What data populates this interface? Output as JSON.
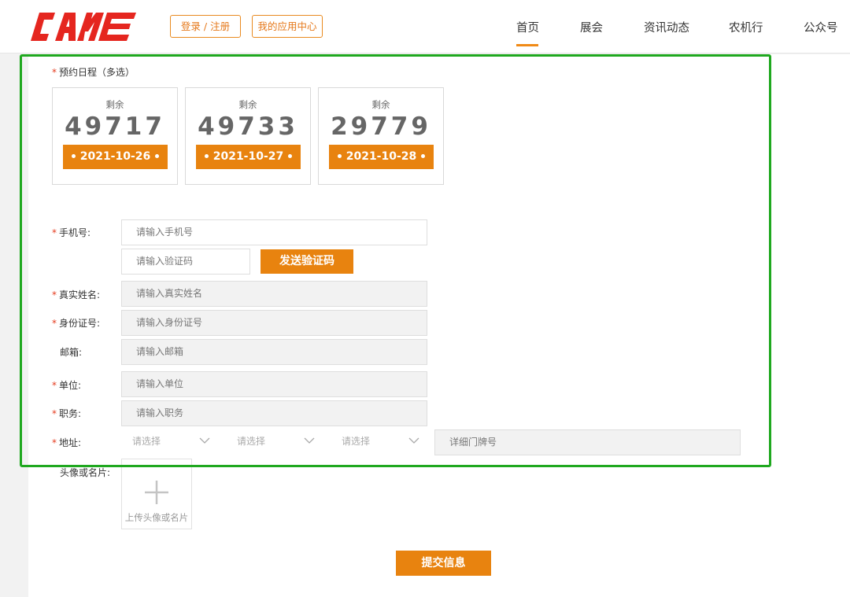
{
  "header": {
    "logo_text": "CAME",
    "login_label": "登录 / 注册",
    "app_center_label": "我的应用中心",
    "nav": [
      "首页",
      "展会",
      "资讯动态",
      "农机行",
      "公众号"
    ],
    "active_nav": "首页"
  },
  "schedule": {
    "label": "预约日程（多选）",
    "cards": [
      {
        "remain_label": "剩余",
        "count": "49717",
        "date": "2021-10-26"
      },
      {
        "remain_label": "剩余",
        "count": "49733",
        "date": "2021-10-27"
      },
      {
        "remain_label": "剩余",
        "count": "29779",
        "date": "2021-10-28"
      }
    ]
  },
  "form": {
    "phone_label": "手机号:",
    "phone_placeholder": "请输入手机号",
    "code_placeholder": "请输入验证码",
    "send_code_label": "发送验证码",
    "name_label": "真实姓名:",
    "name_placeholder": "请输入真实姓名",
    "id_label": "身份证号:",
    "id_placeholder": "请输入身份证号",
    "email_label": "邮箱:",
    "email_placeholder": "请输入邮箱",
    "company_label": "单位:",
    "company_placeholder": "请输入单位",
    "position_label": "职务:",
    "position_placeholder": "请输入职务",
    "address_label": "地址:",
    "address_selects": [
      "请选择",
      "请选择",
      "请选择"
    ],
    "address_detail_placeholder": "详细门牌号",
    "avatar_label": "头像或名片:",
    "upload_label": "上传头像或名片",
    "submit_label": "提交信息"
  },
  "colors": {
    "accent": "#e8830f",
    "required": "#e53b1e",
    "highlight": "#1fa81f"
  }
}
